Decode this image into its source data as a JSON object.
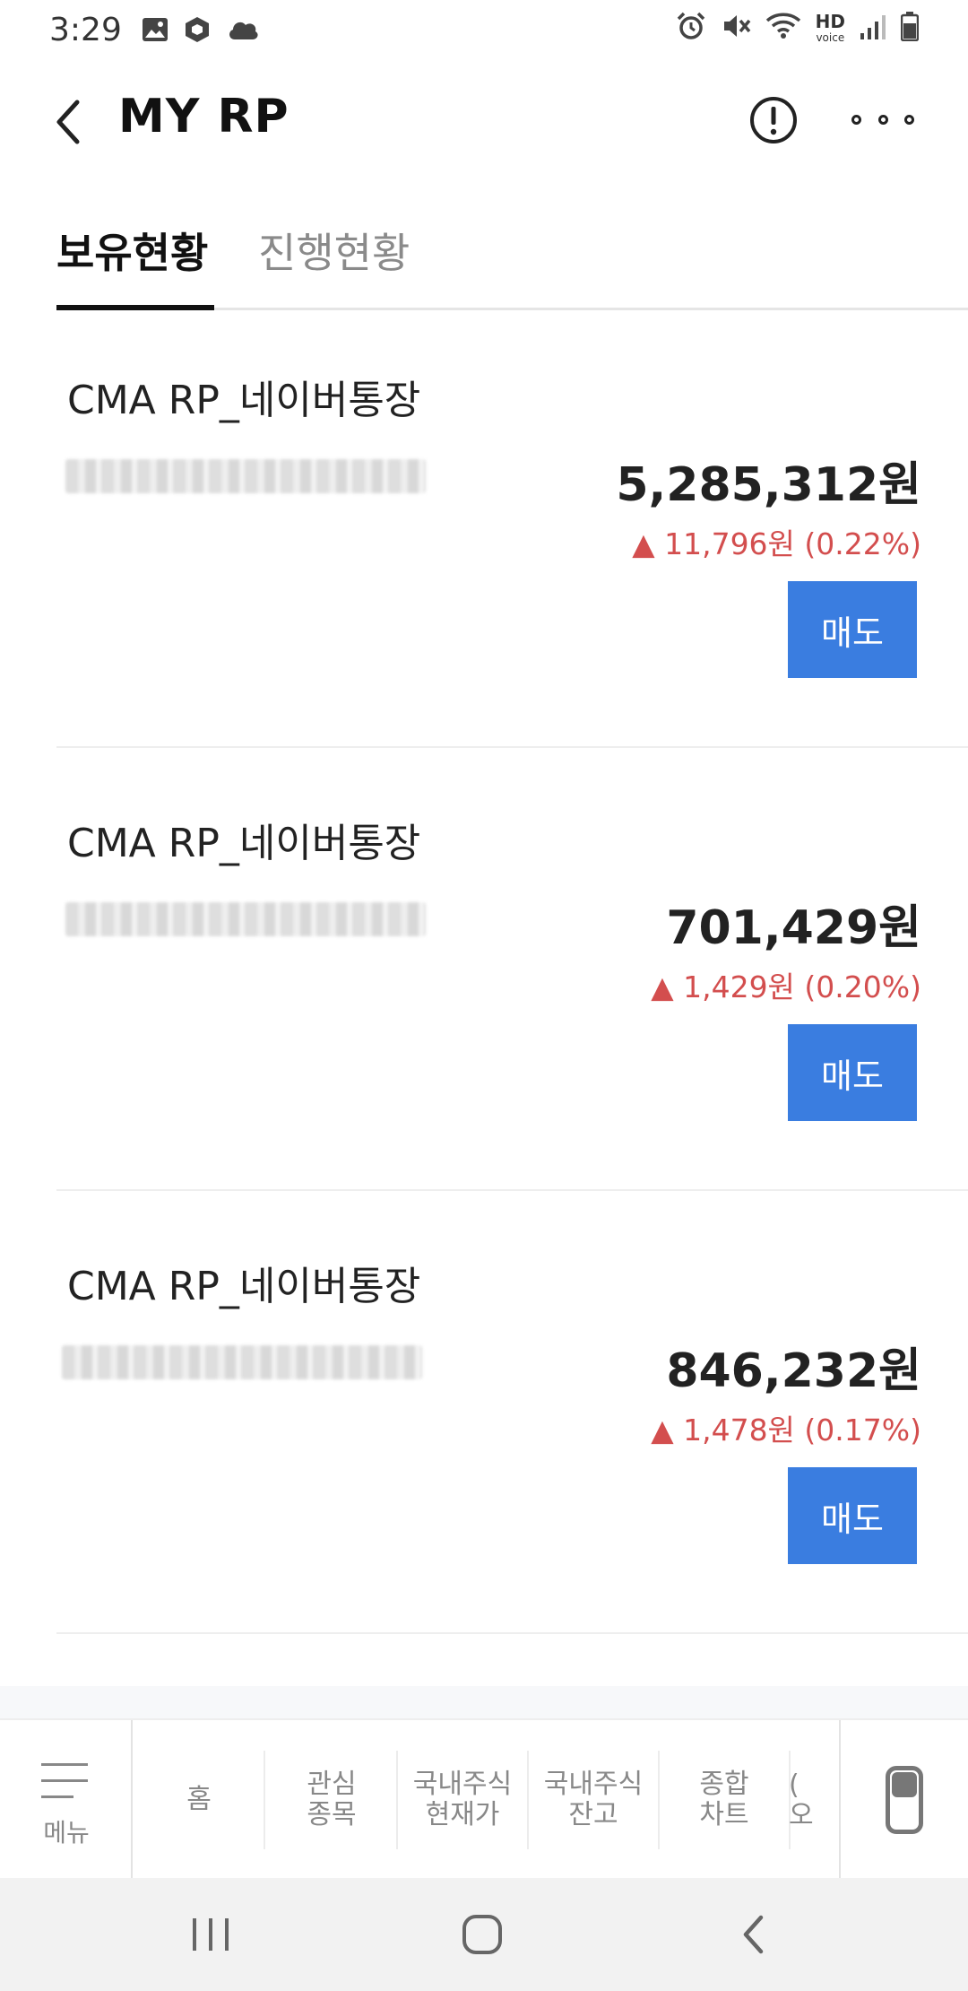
{
  "status_bar": {
    "time": "3:29",
    "left_icons": [
      "gallery-icon",
      "box-icon",
      "cloud-icon"
    ],
    "right_icons": [
      "alarm-icon",
      "mute-icon",
      "wifi-icon",
      "hd-voice-icon",
      "signal-icon",
      "battery-icon"
    ],
    "hd_label": "HD",
    "voice_label": "voice"
  },
  "header": {
    "title": "MY RP",
    "back_icon": "chevron-left-icon",
    "info_icon": "info-icon",
    "more_icon": "more-icon"
  },
  "tabs": [
    {
      "label": "보유현황",
      "active": true
    },
    {
      "label": "진행현황",
      "active": false
    }
  ],
  "holdings": [
    {
      "name": "CMA RP_네이버통장",
      "amount": "5,285,312원",
      "change": "▲ 11,796원 (0.22%)",
      "sell_label": "매도"
    },
    {
      "name": "CMA RP_네이버통장",
      "amount": "701,429원",
      "change": "▲ 1,429원 (0.20%)",
      "sell_label": "매도"
    },
    {
      "name": "CMA RP_네이버통장",
      "amount": "846,232원",
      "change": "▲ 1,478원 (0.17%)",
      "sell_label": "매도"
    }
  ],
  "bottom_nav": {
    "menu_label": "메뉴",
    "items": [
      {
        "label": "홈"
      },
      {
        "label": "관심\n종목"
      },
      {
        "label": "국내주식\n현재가"
      },
      {
        "label": "국내주식\n잔고"
      },
      {
        "label": "종합\n차트"
      },
      {
        "label": "(\n오"
      }
    ]
  },
  "colors": {
    "accent": "#3a7de0",
    "rise": "#d34e4e"
  }
}
